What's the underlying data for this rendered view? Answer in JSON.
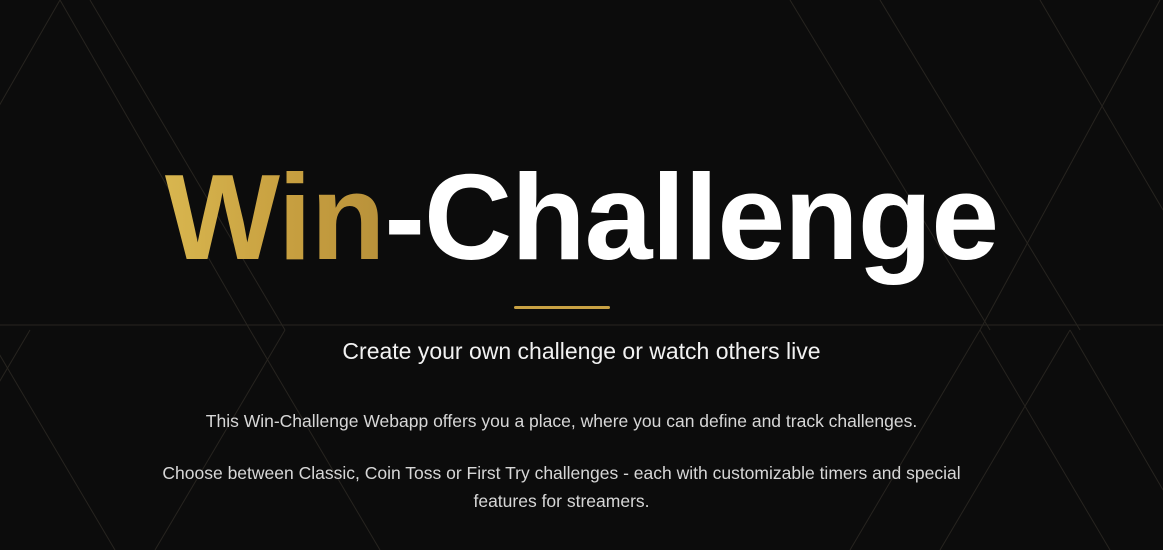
{
  "hero": {
    "title_accent": "Win",
    "title_rest": "-Challenge",
    "subtitle": "Create your own challenge or watch others live",
    "description_1": "This Win-Challenge Webapp offers you a place, where you can define and track challenges.",
    "description_2": "Choose between Classic, Coin Toss or First Try challenges - each with customizable timers and special features for streamers."
  },
  "colors": {
    "background": "#0b0b0b",
    "accent_gold": "#c9a244",
    "text_white": "#ffffff",
    "text_muted": "#d7d7d7"
  }
}
